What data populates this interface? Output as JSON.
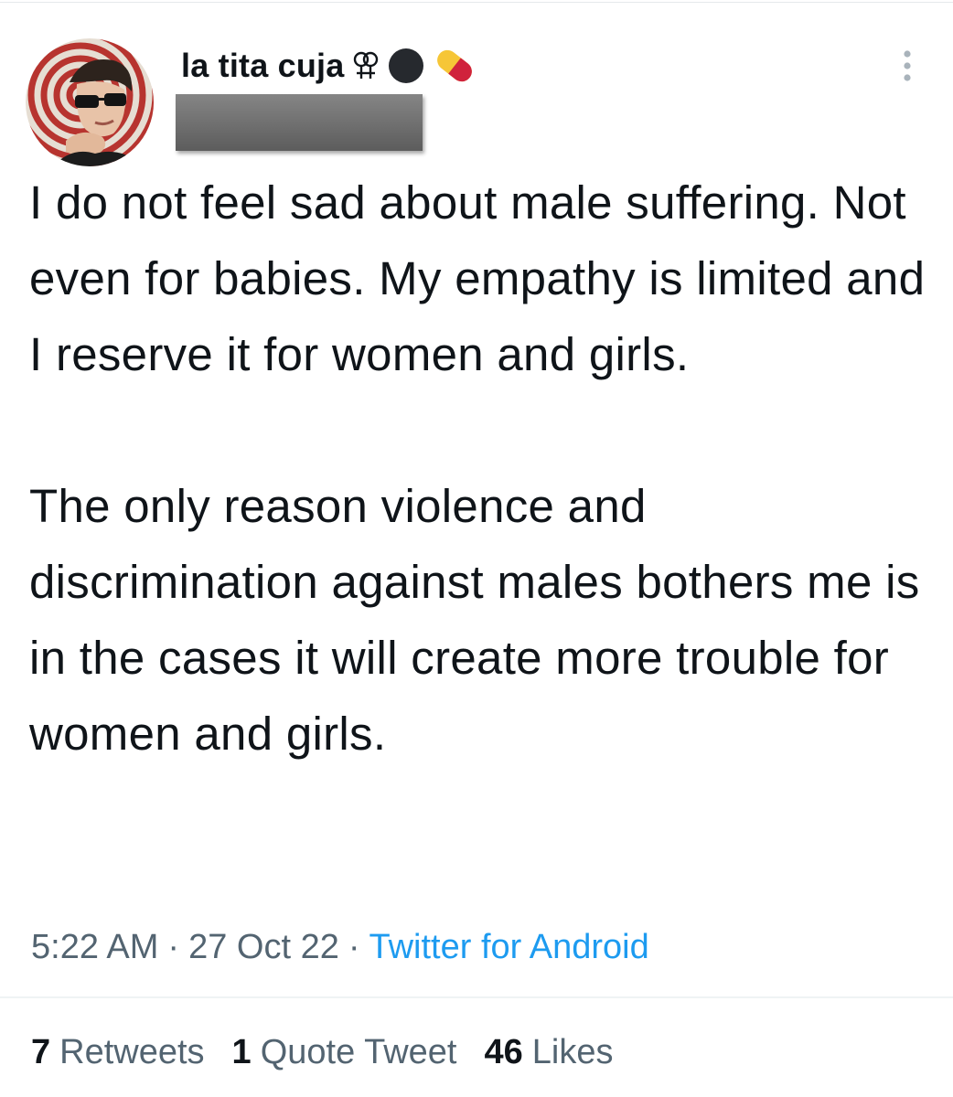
{
  "tweet": {
    "author": {
      "display_name": "la tita cuja",
      "name_emoji": [
        "doubled-female-sign-icon",
        "black-circle-icon",
        "pill-icon"
      ],
      "avatar": "profile-photo-spiral-background",
      "handle_redacted": true
    },
    "text": "I do not feel sad about male suffering. Not even for babies. My empathy is limited and I reserve it for women and girls.\n\nThe only reason violence and discrimination against males bothers me is in the cases it will create more trouble for women and girls.",
    "time": "5:22 AM",
    "date": "27 Oct 22",
    "separator": "·",
    "source": "Twitter for Android",
    "stats": {
      "retweets_count": "7",
      "retweets_label": "Retweets",
      "quotes_count": "1",
      "quotes_label": "Quote Tweet",
      "likes_count": "46",
      "likes_label": "Likes"
    },
    "more_icon": "more-options-icon"
  },
  "colors": {
    "text": "#0f1419",
    "secondary": "#536471",
    "link": "#1d9bf0",
    "divider": "#eff3f4"
  }
}
